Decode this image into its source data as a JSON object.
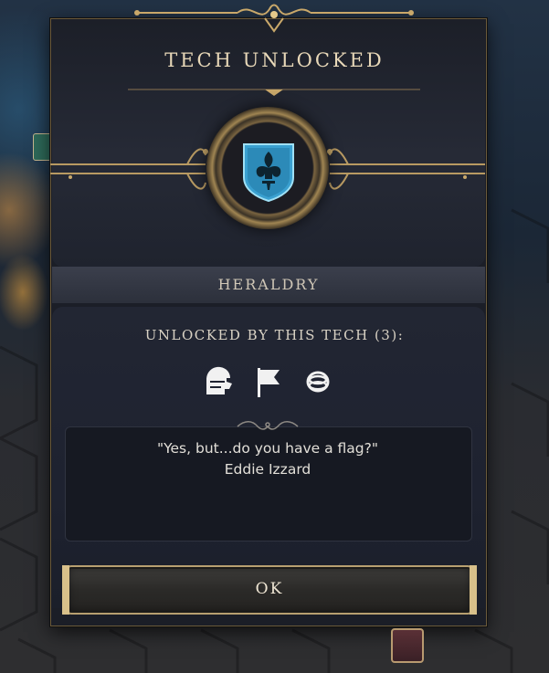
{
  "dialog": {
    "title": "TECH UNLOCKED",
    "tech_name": "HERALDRY",
    "unlocks_label": "UNLOCKED BY THIS TECH (3):",
    "unlocks": [
      {
        "icon": "knight-helmet-icon"
      },
      {
        "icon": "flag-icon"
      },
      {
        "icon": "ring-icon"
      }
    ],
    "quote": {
      "text": "\"Yes, but...do you have a flag?\"",
      "author": "Eddie Izzard"
    },
    "ok_label": "OK",
    "tech_icon": "fleur-de-lis-shield-icon"
  },
  "colors": {
    "accent_gold": "#b8a070",
    "title_text": "#e8d8b8",
    "shield_blue": "#3aa0d0"
  }
}
